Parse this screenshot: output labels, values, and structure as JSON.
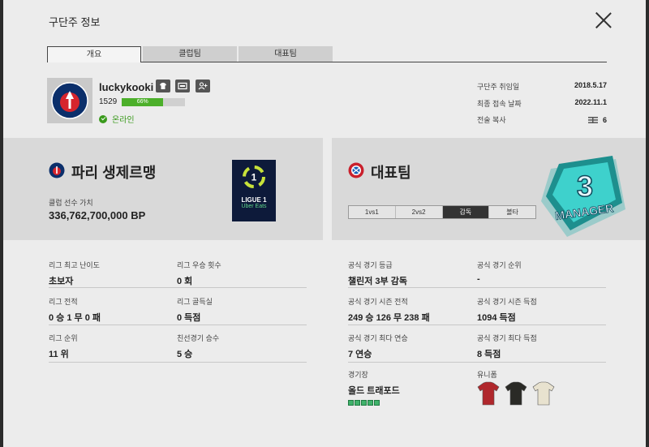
{
  "window": {
    "title": "구단주 정보"
  },
  "tabs": [
    {
      "label": "개요",
      "active": true
    },
    {
      "label": "클럽팀",
      "active": false
    },
    {
      "label": "대표팀",
      "active": false
    }
  ],
  "profile": {
    "username": "luckykooki",
    "level": "1529",
    "progress_percent": 66,
    "progress_label": "66%",
    "status": "온라인",
    "icons": [
      "shirt-icon",
      "card-icon",
      "add-friend-icon"
    ]
  },
  "info": [
    {
      "label": "구단주 취임일",
      "value": "2018.5.17"
    },
    {
      "label": "최종 접속 날짜",
      "value": "2022.11.1"
    },
    {
      "label": "전술 복사",
      "value": "6"
    }
  ],
  "club": {
    "name": "파리 생제르맹",
    "value_label": "클럽 선수 가치",
    "value": "336,762,700,000 BP",
    "league_logo": {
      "line1": "LIGUE 1",
      "line2": "Uber Eats"
    }
  },
  "national_team": {
    "title": "대표팀",
    "modes": [
      {
        "label": "1vs1",
        "active": false
      },
      {
        "label": "2vs2",
        "active": false
      },
      {
        "label": "감독",
        "active": true
      },
      {
        "label": "볼타",
        "active": false
      }
    ],
    "badge": {
      "number": "3",
      "text": "MANAGER"
    }
  },
  "club_stats": [
    {
      "label": "리그 최고 난이도",
      "value": "초보자"
    },
    {
      "label": "리그 우승 횟수",
      "value": "0 회"
    },
    {
      "label": "리그 전적",
      "value": "0 승 1 무 0 패"
    },
    {
      "label": "리그 골득실",
      "value": "0 득점"
    },
    {
      "label": "리그 순위",
      "value": "11 위"
    },
    {
      "label": "친선경기 승수",
      "value": "5 승"
    }
  ],
  "team_stats": [
    {
      "label": "공식 경기 등급",
      "value": "챌린저 3부 감독"
    },
    {
      "label": "공식 경기 순위",
      "value": "-"
    },
    {
      "label": "공식 경기 시즌 전적",
      "value": "249 승 126 무 238 패"
    },
    {
      "label": "공식 경기 시즌 득점",
      "value": "1094 득점"
    },
    {
      "label": "공식 경기 최다 연승",
      "value": "7 연승"
    },
    {
      "label": "공식 경기 최다 득점",
      "value": "8 득점"
    }
  ],
  "stadium": {
    "label": "경기장",
    "value": "올드 트래포드",
    "stars": 5
  },
  "uniform": {
    "label": "유니폼",
    "kits": [
      "#b0272c",
      "#2a2a26",
      "#e8e2cf"
    ]
  },
  "colors": {
    "accent_green": "#4caf2a",
    "online_green": "#3a9a1c",
    "league_bg": "#0d1a3a"
  }
}
